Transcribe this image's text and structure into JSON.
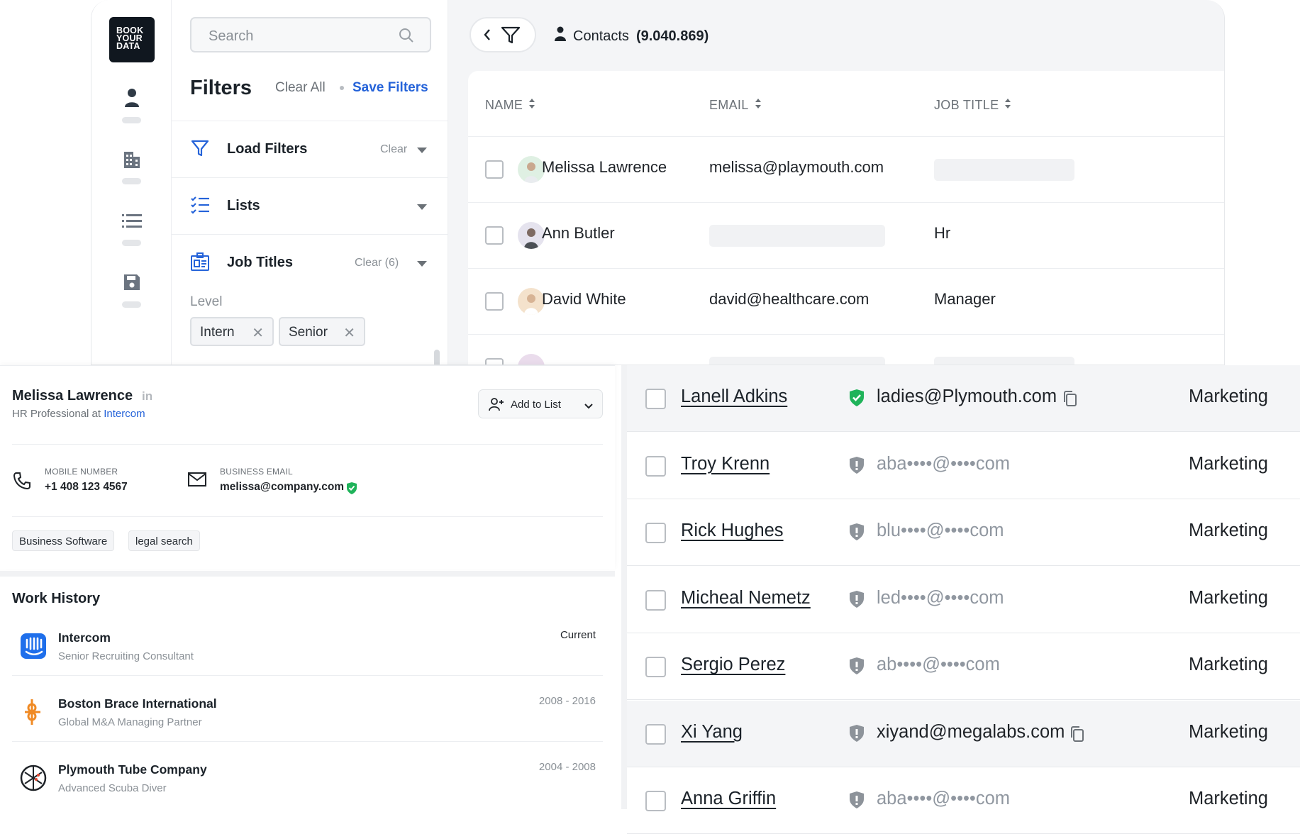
{
  "app": {
    "logo_text": [
      "BOOK",
      "YOUR",
      "DATA"
    ]
  },
  "sidebar": {
    "icons": [
      "user-icon",
      "building-icon",
      "list-icon",
      "save-icon"
    ]
  },
  "filters": {
    "search_placeholder": "Search",
    "title": "Filters",
    "clear_all": "Clear All",
    "save_filters": "Save Filters",
    "rows": [
      {
        "label": "Load Filters",
        "clear": "Clear",
        "icon": "filter-icon"
      },
      {
        "label": "Lists",
        "clear": "",
        "icon": "checklist-icon"
      },
      {
        "label": "Job Titles",
        "clear": "Clear (6)",
        "icon": "id-badge-icon"
      }
    ],
    "level_label": "Level",
    "chips": [
      "Intern",
      "Senior"
    ]
  },
  "contacts": {
    "label": "Contacts",
    "count": "(9.040.869)",
    "columns": [
      "NAME",
      "EMAIL",
      "JOB TITLE"
    ],
    "rows": [
      {
        "name": "Melissa Lawrence",
        "email": "melissa@playmouth.com",
        "job_title": ""
      },
      {
        "name": "Ann Butler",
        "email": "",
        "job_title": "Hr"
      },
      {
        "name": "David White",
        "email": "david@healthcare.com",
        "job_title": "Manager"
      }
    ]
  },
  "profile": {
    "name": "Melissa Lawrence",
    "linkedin": "in",
    "role_prefix": "HR Professional at ",
    "company": "Intercom",
    "add_to_list": "Add to List",
    "mobile_label": "MOBILE NUMBER",
    "mobile_value": "+1 408 123 4567",
    "email_label": "BUSINESS EMAIL",
    "email_value": "melissa@company.com",
    "tags": [
      "Business Software",
      "legal search"
    ]
  },
  "work_history": {
    "title": "Work History",
    "items": [
      {
        "company": "Intercom",
        "title": "Senior Recruiting Consultant",
        "dates": "Current"
      },
      {
        "company": "Boston Brace International",
        "title": "Global M&A Managing Partner",
        "dates": "2008 - 2016"
      },
      {
        "company": "Plymouth Tube Company",
        "title": "Advanced Scuba Diver",
        "dates": "2004 - 2008"
      }
    ]
  },
  "people": [
    {
      "name": "Lanell Adkins",
      "email": "ladies@Plymouth.com",
      "verified": true,
      "job": "Marketing"
    },
    {
      "name": "Troy Krenn",
      "email": "aba••••@••••com",
      "verified": false,
      "job": "Marketing"
    },
    {
      "name": "Rick Hughes",
      "email": "blu••••@••••com",
      "verified": false,
      "job": "Marketing"
    },
    {
      "name": "Micheal Nemetz",
      "email": "led••••@••••com",
      "verified": false,
      "job": "Marketing"
    },
    {
      "name": "Sergio Perez",
      "email": "ab••••@••••com",
      "verified": false,
      "job": "Marketing"
    },
    {
      "name": "Xi Yang",
      "email": "xiyand@megalabs.com",
      "verified": false,
      "job": "Marketing"
    },
    {
      "name": "Anna Griffin",
      "email": "aba••••@••••com",
      "verified": false,
      "job": "Marketing"
    }
  ],
  "colors": {
    "accent": "#2563d9",
    "verified": "#1fb35a",
    "masked_shield": "#8d939a"
  }
}
